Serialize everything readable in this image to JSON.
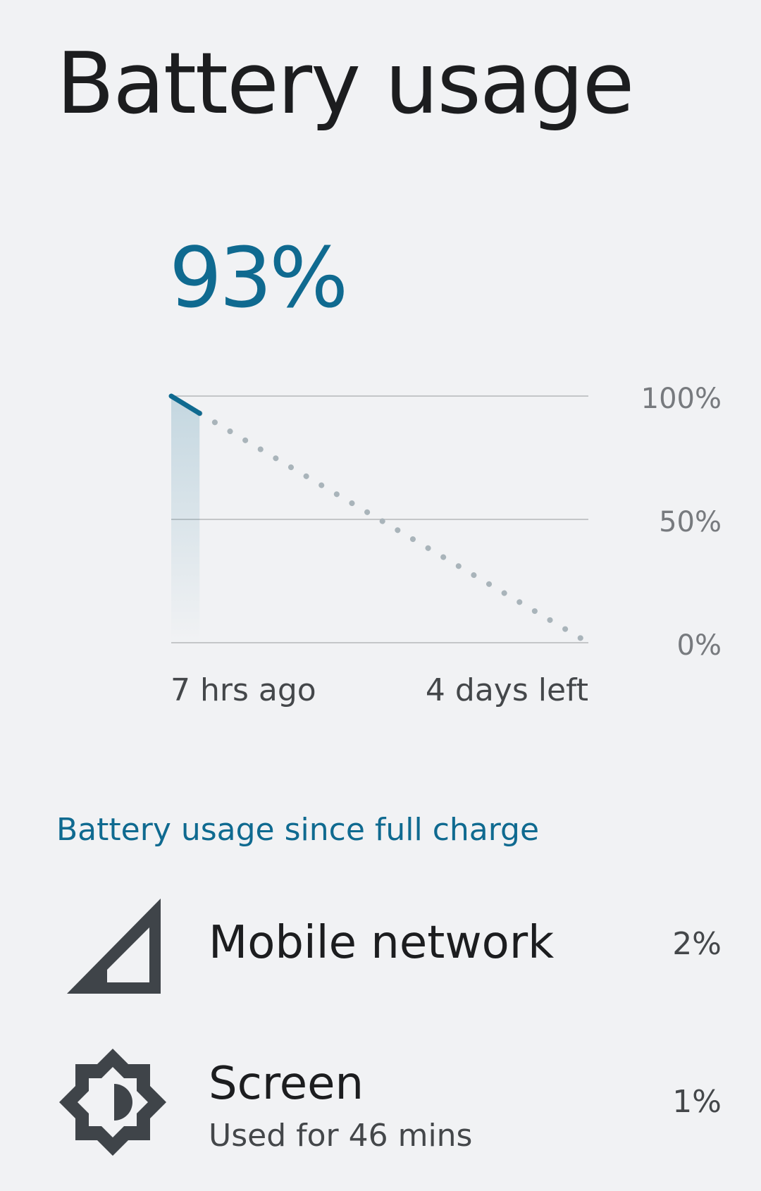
{
  "header": {
    "title": "Battery usage"
  },
  "battery": {
    "level": "93%"
  },
  "chart_data": {
    "type": "line",
    "y_ticks": [
      "100%",
      "50%",
      "0%"
    ],
    "ylim": [
      0,
      100
    ],
    "x_labels": {
      "start": "7 hrs ago",
      "end": "4 days left"
    },
    "series": [
      {
        "kind": "history",
        "x": [
          0,
          7
        ],
        "y": [
          100,
          93
        ],
        "style": "solid"
      },
      {
        "kind": "prediction",
        "x": [
          7,
          103
        ],
        "y": [
          93,
          0
        ],
        "style": "dotted"
      }
    ],
    "colors": {
      "history": "#0f6a90",
      "prediction": "#a9b4ba",
      "grid": "#c4c6c8"
    }
  },
  "usage": {
    "section_title": "Battery usage since full charge",
    "items": [
      {
        "name": "Mobile network",
        "subtitle": "",
        "percent": "2%",
        "icon": "cell-signal-icon"
      },
      {
        "name": "Screen",
        "subtitle": "Used for 46 mins",
        "percent": "1%",
        "icon": "brightness-icon"
      }
    ]
  },
  "colors": {
    "accent": "#0f6a90",
    "background": "#f1f2f4",
    "icon": "#3f4449"
  }
}
